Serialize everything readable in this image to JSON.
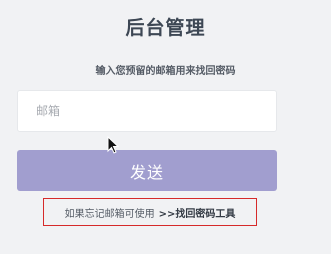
{
  "header": {
    "title": "后台管理",
    "subtitle": "输入您预留的邮箱用来找回密码"
  },
  "form": {
    "email_placeholder": "邮箱",
    "email_value": "",
    "send_label": "发送"
  },
  "footer": {
    "hint_text": "如果忘记邮箱可使用",
    "tool_link": ">>找回密码工具"
  },
  "colors": {
    "background": "#f1f2f4",
    "send_button": "#a19ecf",
    "highlight_border": "#d62a2a"
  }
}
